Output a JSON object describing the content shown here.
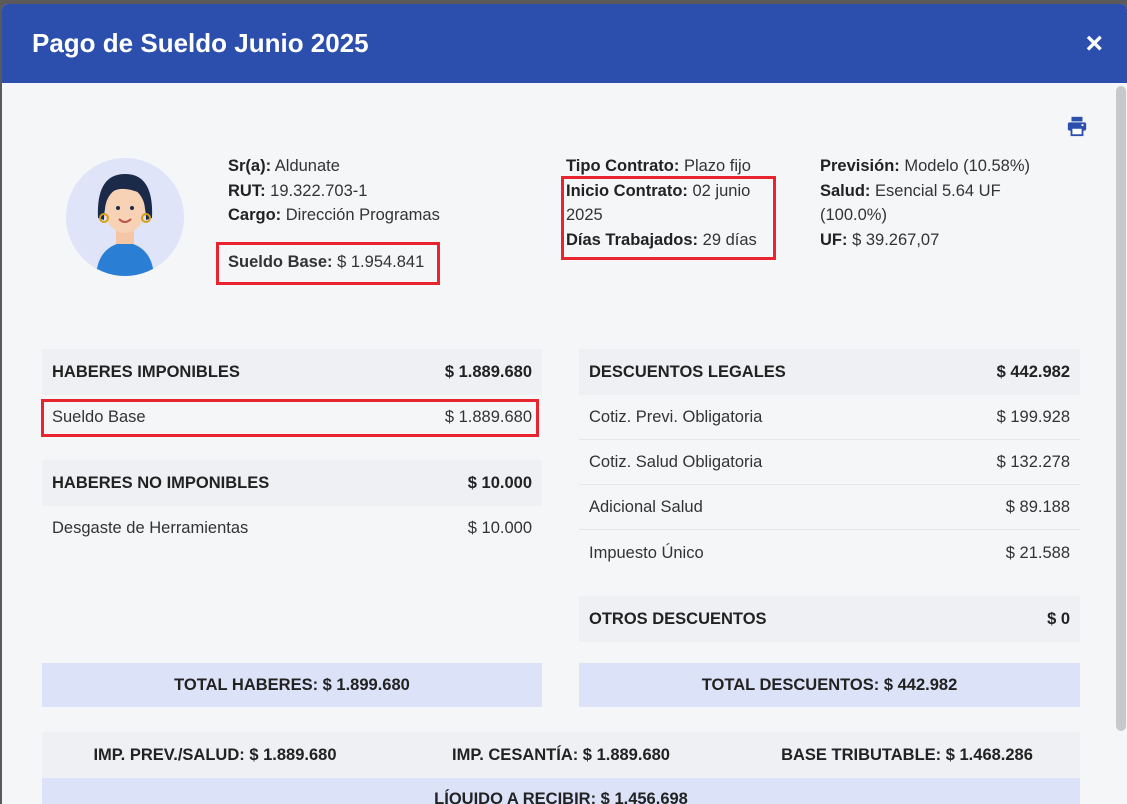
{
  "header": {
    "title": "Pago de Sueldo Junio 2025",
    "close_label": "×"
  },
  "employee": {
    "name_label": "Sr(a):",
    "name": "Aldunate",
    "rut_label": "RUT:",
    "rut": "19.322.703-1",
    "cargo_label": "Cargo:",
    "cargo": "Dirección Programas",
    "sueldo_base_label": "Sueldo Base:",
    "sueldo_base": "$ 1.954.841"
  },
  "contract": {
    "tipo_label": "Tipo Contrato:",
    "tipo": "Plazo fijo",
    "inicio_label": "Inicio Contrato:",
    "inicio": "02 junio 2025",
    "dias_label": "Días Trabajados:",
    "dias": "29 días"
  },
  "prevision": {
    "prevision_label": "Previsión:",
    "prevision": "Modelo (10.58%)",
    "salud_label": "Salud:",
    "salud": "Esencial 5.64 UF (100.0%)",
    "uf_label": "UF:",
    "uf": "$ 39.267,07"
  },
  "haberes_imponibles": {
    "title": "HABERES IMPONIBLES",
    "total": "$ 1.889.680",
    "items": [
      {
        "label": "Sueldo Base",
        "value": "$ 1.889.680"
      }
    ]
  },
  "haberes_no_imponibles": {
    "title": "HABERES NO IMPONIBLES",
    "total": "$ 10.000",
    "items": [
      {
        "label": "Desgaste de Herramientas",
        "value": "$ 10.000"
      }
    ]
  },
  "descuentos_legales": {
    "title": "DESCUENTOS LEGALES",
    "total": "$ 442.982",
    "items": [
      {
        "label": "Cotiz. Previ. Obligatoria",
        "value": "$ 199.928"
      },
      {
        "label": "Cotiz. Salud Obligatoria",
        "value": "$ 132.278"
      },
      {
        "label": "Adicional Salud",
        "value": "$ 89.188"
      },
      {
        "label": "Impuesto Único",
        "value": "$ 21.588"
      }
    ]
  },
  "otros_descuentos": {
    "title": "OTROS DESCUENTOS",
    "total": "$ 0"
  },
  "totals": {
    "haberes": "TOTAL HABERES: $ 1.899.680",
    "descuentos": "TOTAL DESCUENTOS: $ 442.982"
  },
  "summary": {
    "imp_prev_salud": "IMP. PREV./SALUD: $ 1.889.680",
    "imp_cesantia": "IMP. CESANTÍA: $ 1.889.680",
    "base_tributable": "BASE TRIBUTABLE: $ 1.468.286",
    "liquido": "LÍQUIDO A RECIBIR: $ 1.456.698"
  },
  "colors": {
    "header": "#2c4fae",
    "highlight": "#e8242f",
    "total_bg": "#dce3f8"
  },
  "icons": {
    "print": "printer-icon",
    "close": "close-icon",
    "avatar": "avatar"
  }
}
